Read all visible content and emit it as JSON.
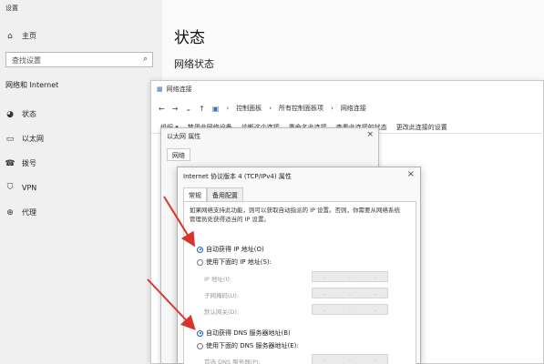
{
  "settings": {
    "window_title": "设置",
    "home_label": "主页",
    "search_placeholder": "查找设置",
    "section_label": "网络和 Internet",
    "nav": [
      {
        "icon": "globe-icon",
        "label": "状态"
      },
      {
        "icon": "monitor-icon",
        "label": "以太网"
      },
      {
        "icon": "phone-icon",
        "label": "拨号"
      },
      {
        "icon": "shield-icon",
        "label": "VPN"
      },
      {
        "icon": "globe-icon",
        "label": "代理"
      }
    ],
    "page_title": "状态",
    "page_subtitle": "网络状态"
  },
  "explorer": {
    "title": "网络连接",
    "breadcrumb": [
      "控制面板",
      "所有控制面板项",
      "网络连接"
    ],
    "toolbar": [
      "组织 ▾",
      "禁用此网络设备",
      "诊断这个连接",
      "重命名此连接",
      "查看此连接的状态",
      "更改此连接的设置"
    ]
  },
  "ethernet_props": {
    "title": "以太网 属性",
    "tab": "网络"
  },
  "ipv4": {
    "title": "Internet 协议版本 4 (TCP/IPv4) 属性",
    "tabs": [
      "常规",
      "备用配置"
    ],
    "description": "如果网络支持此功能，则可以获取自动指派的 IP 设置。否则，你需要从网络系统管理员处获得适当的 IP 设置。",
    "auto_ip": "自动获得 IP 地址(O)",
    "manual_ip": "使用下面的 IP 地址(S):",
    "fields": [
      "IP 地址(I):",
      "子网掩码(U):",
      "默认网关(D):"
    ],
    "auto_dns": "自动获得 DNS 服务器地址(B)",
    "manual_dns": "使用下面的 DNS 服务器地址(E):",
    "dns_fields": [
      "首选 DNS 服务器(P):"
    ]
  },
  "colors": {
    "arrow": "#d9342b",
    "radio_selected": "#1a62b8"
  }
}
